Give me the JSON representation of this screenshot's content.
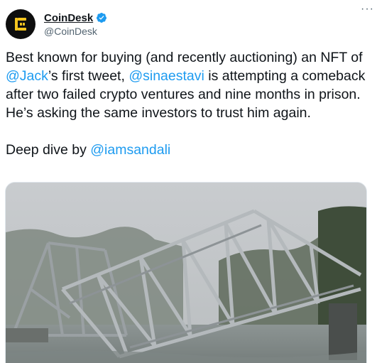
{
  "author": {
    "display_name": "CoinDesk",
    "handle": "@CoinDesk",
    "avatar_icon": "coindesk-logo-icon",
    "verified_icon": "verified-badge-icon",
    "verified_color": "#1d9bf0"
  },
  "menu": {
    "more_label": "···"
  },
  "tweet": {
    "line1_a": "Best known for buying (and recently auctioning) an NFT of ",
    "mention_jack": "@Jack",
    "line1_b": "’s first tweet, ",
    "mention_sina": "@sinaestavi",
    "line1_c": " is attempting a comeback after two failed crypto ventures and nine months in prison. He’s asking the same investors to trust him again.",
    "line2_a": "Deep dive by ",
    "mention_iam": "@iamsandali"
  },
  "colors": {
    "link": "#1d9bf0",
    "text": "#0f1419",
    "secondary": "#536471",
    "logo_yellow": "#f5c51f"
  },
  "media": {
    "icon": "collapsed-bridge-photo"
  }
}
